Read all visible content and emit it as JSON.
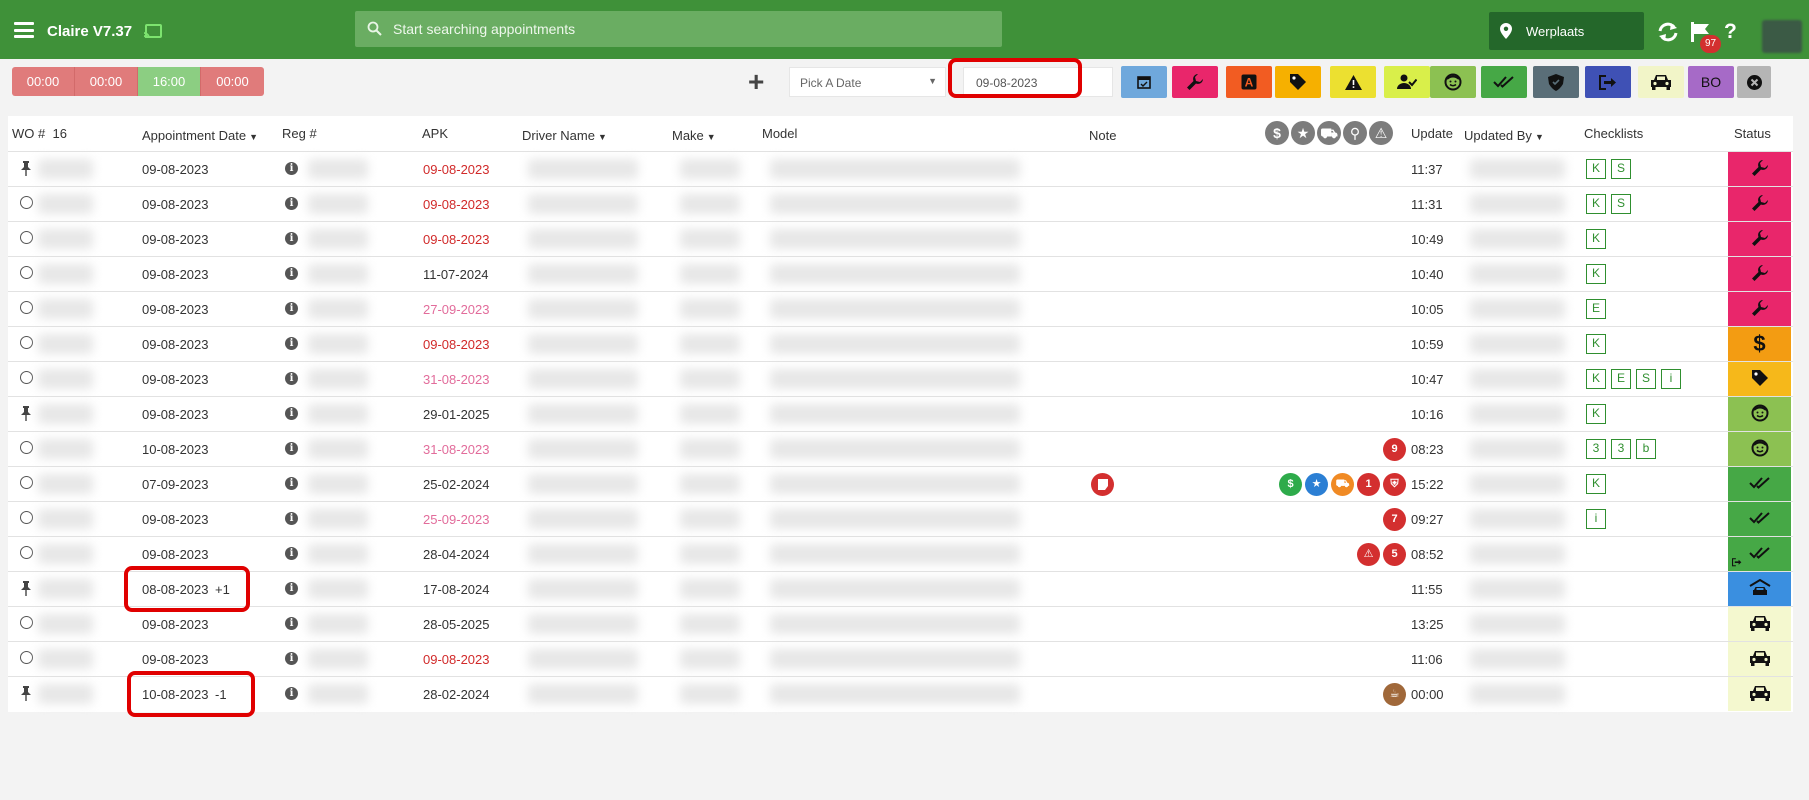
{
  "app": {
    "title": "Claire V7.37"
  },
  "search": {
    "placeholder": "Start searching appointments"
  },
  "location": {
    "label": "Werplaats"
  },
  "notifications": {
    "count": "97"
  },
  "timers": [
    "00:00",
    "00:00",
    "16:00",
    "00:00"
  ],
  "toolbar": {
    "date_select": "Pick A Date",
    "date_value": "09-08-2023"
  },
  "filters": [
    {
      "name": "calendar-filter",
      "color": "#6fa8dc",
      "icon": "calendar-icon"
    },
    {
      "name": "repair-filter",
      "color": "#e9266b",
      "icon": "wrench-icon"
    },
    {
      "name": "apk-filter",
      "color": "#f25c22",
      "icon": "a-letter-icon"
    },
    {
      "name": "tag-filter",
      "color": "#f6b000",
      "icon": "tag-icon"
    },
    {
      "name": "warning-filter",
      "color": "#ece030",
      "icon": "warning-icon"
    },
    {
      "name": "user-check-filter",
      "color": "#d9ef4a",
      "icon": "user-check-icon"
    },
    {
      "name": "customer-filter",
      "color": "#8cc152",
      "icon": "smiley-icon"
    },
    {
      "name": "done-filter",
      "color": "#46a846",
      "icon": "double-check-icon"
    },
    {
      "name": "shield-filter",
      "color": "#5a6e78",
      "icon": "shield-icon"
    },
    {
      "name": "logout-filter",
      "color": "#3f51b5",
      "icon": "sign-out-icon"
    },
    {
      "name": "car-filter",
      "color": "#f2f5c8",
      "icon": "car-icon"
    },
    {
      "name": "bo-filter",
      "color": "#a66ac7",
      "icon": "bo-text",
      "text": "BO"
    },
    {
      "name": "clear-filter",
      "color": "#b5b5b5",
      "icon": "close-circle-icon"
    }
  ],
  "columns": {
    "wo": "WO #",
    "wo_count": "16",
    "appointment_date": "Appointment Date",
    "reg": "Reg #",
    "apk": "APK",
    "driver": "Driver Name",
    "make": "Make",
    "model": "Model",
    "note": "Note",
    "update": "Update",
    "updated_by": "Updated By",
    "checklists": "Checklists",
    "status": "Status"
  },
  "rows": [
    {
      "marker": "pin",
      "date": "09-08-2023",
      "apk": "09-08-2023",
      "apk_style": "red",
      "update": "11:37",
      "checklist": [
        "K",
        "S"
      ],
      "status": "repair",
      "badges": []
    },
    {
      "marker": "radio",
      "date": "09-08-2023",
      "apk": "09-08-2023",
      "apk_style": "red",
      "update": "11:31",
      "checklist": [
        "K",
        "S"
      ],
      "status": "repair",
      "badges": []
    },
    {
      "marker": "radio",
      "date": "09-08-2023",
      "apk": "09-08-2023",
      "apk_style": "red",
      "update": "10:49",
      "checklist": [
        "K"
      ],
      "status": "repair",
      "badges": []
    },
    {
      "marker": "radio",
      "date": "09-08-2023",
      "apk": "11-07-2024",
      "apk_style": "normal",
      "update": "10:40",
      "checklist": [
        "K"
      ],
      "status": "repair",
      "badges": []
    },
    {
      "marker": "radio",
      "date": "09-08-2023",
      "apk": "27-09-2023",
      "apk_style": "pink",
      "update": "10:05",
      "checklist": [
        "E"
      ],
      "status": "repair",
      "badges": []
    },
    {
      "marker": "radio",
      "date": "09-08-2023",
      "apk": "09-08-2023",
      "apk_style": "red",
      "update": "10:59",
      "checklist": [
        "K"
      ],
      "status": "payment",
      "badges": []
    },
    {
      "marker": "radio",
      "date": "09-08-2023",
      "apk": "31-08-2023",
      "apk_style": "pink",
      "update": "10:47",
      "checklist": [
        "K",
        "E",
        "S",
        "i"
      ],
      "status": "tag",
      "badges": []
    },
    {
      "marker": "pin",
      "date": "09-08-2023",
      "apk": "29-01-2025",
      "apk_style": "normal",
      "update": "10:16",
      "checklist": [
        "K"
      ],
      "status": "customer",
      "badges": []
    },
    {
      "marker": "radio",
      "date": "10-08-2023",
      "apk": "31-08-2023",
      "apk_style": "pink",
      "update": "08:23",
      "checklist": [
        "3",
        "3",
        "b"
      ],
      "status": "customer",
      "badges": [
        {
          "type": "count",
          "text": "9",
          "color": "#d32f2f"
        }
      ]
    },
    {
      "marker": "radio",
      "date": "07-09-2023",
      "apk": "25-02-2024",
      "apk_style": "normal",
      "update": "15:22",
      "checklist": [
        "K"
      ],
      "status": "done",
      "note_badge": true,
      "badges": [
        {
          "type": "icon",
          "icon": "dollar",
          "color": "#2eab4b"
        },
        {
          "type": "icon",
          "icon": "star",
          "color": "#2b7fd4"
        },
        {
          "type": "icon",
          "icon": "cart",
          "color": "#f08a24"
        },
        {
          "type": "count",
          "text": "1",
          "color": "#d32f2f"
        },
        {
          "type": "icon",
          "icon": "shield",
          "color": "#d32f2f"
        }
      ]
    },
    {
      "marker": "radio",
      "date": "09-08-2023",
      "apk": "25-09-2023",
      "apk_style": "pink",
      "update": "09:27",
      "checklist": [
        "i"
      ],
      "status": "done",
      "badges": [
        {
          "type": "count",
          "text": "7",
          "color": "#d32f2f"
        }
      ]
    },
    {
      "marker": "radio",
      "date": "09-08-2023",
      "apk": "28-04-2024",
      "apk_style": "normal",
      "update": "08:52",
      "checklist": [],
      "status": "done-out",
      "badges": [
        {
          "type": "icon",
          "icon": "warning",
          "color": "#d32f2f"
        },
        {
          "type": "count",
          "text": "5",
          "color": "#d32f2f"
        }
      ]
    },
    {
      "marker": "pin",
      "date": "08-08-2023",
      "date_suffix": "+1",
      "apk": "17-08-2024",
      "apk_style": "normal",
      "update": "11:55",
      "checklist": [],
      "status": "garage",
      "badges": []
    },
    {
      "marker": "radio",
      "date": "09-08-2023",
      "apk": "28-05-2025",
      "apk_style": "normal",
      "update": "13:25",
      "checklist": [],
      "status": "car",
      "badges": []
    },
    {
      "marker": "radio",
      "date": "09-08-2023",
      "apk": "09-08-2023",
      "apk_style": "red",
      "update": "11:06",
      "checklist": [],
      "status": "car",
      "badges": []
    },
    {
      "marker": "pin",
      "date": "10-08-2023",
      "date_suffix": "-1",
      "apk": "28-02-2024",
      "apk_style": "normal",
      "update": "00:00",
      "checklist": [],
      "status": "car",
      "badges": [
        {
          "type": "icon",
          "icon": "coffee",
          "color": "#a0683a"
        }
      ]
    }
  ],
  "status_colors": {
    "repair": "#e9266b",
    "payment": "#f39c12",
    "tag": "#f6b81a",
    "customer": "#8cc152",
    "done": "#46a846",
    "done-out": "#46a846",
    "garage": "#3a8fe0",
    "car": "#f4f8cf"
  }
}
